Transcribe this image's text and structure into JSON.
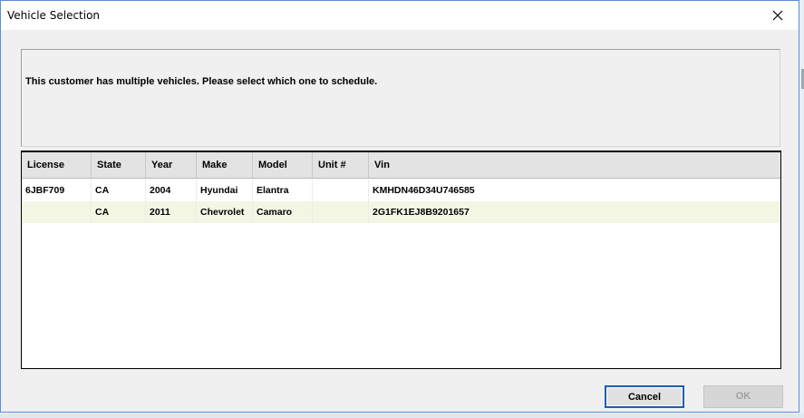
{
  "window": {
    "title": "Vehicle Selection"
  },
  "message": "This customer has multiple vehicles. Please select which one to schedule.",
  "grid": {
    "columns": [
      "License",
      "State",
      "Year",
      "Make",
      "Model",
      "Unit #",
      "Vin"
    ],
    "rows": [
      {
        "license": "6JBF709",
        "state": "CA",
        "year": "2004",
        "make": "Hyundai",
        "model": "Elantra",
        "unit": "",
        "vin": "KMHDN46D34U746585"
      },
      {
        "license": "",
        "state": "CA",
        "year": "2011",
        "make": "Chevrolet",
        "model": "Camaro",
        "unit": "",
        "vin": "2G1FK1EJ8B9201657"
      }
    ]
  },
  "buttons": {
    "cancel": "Cancel",
    "ok": "OK"
  },
  "colors": {
    "selected_row": "#f4f6e4",
    "default_button_border": "#1a5fb4",
    "window_border": "#5b8fd6"
  },
  "icons": {
    "close": "close-icon"
  }
}
